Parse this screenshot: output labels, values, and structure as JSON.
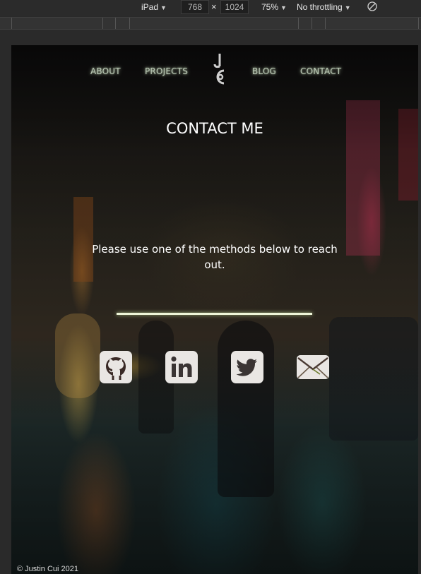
{
  "devtools": {
    "device": "iPad",
    "width": "768",
    "times": "×",
    "height": "1024",
    "zoom": "75%",
    "throttling": "No throttling"
  },
  "nav": {
    "items": [
      {
        "label": "ABOUT"
      },
      {
        "label": "PROJECTS"
      },
      {
        "label": "BLOG"
      },
      {
        "label": "CONTACT"
      }
    ],
    "logo_letters": "JC"
  },
  "page": {
    "title": "CONTACT ME",
    "message": "Please use one of the methods below to reach out."
  },
  "social": {
    "icons": [
      "github-icon",
      "linkedin-icon",
      "twitter-icon",
      "email-icon"
    ]
  },
  "footer": {
    "copyright": "© Justin Cui 2021"
  },
  "colors": {
    "nav_glow": "#b9c7b4",
    "underline": "#eef5d8",
    "text": "#ffffff"
  }
}
